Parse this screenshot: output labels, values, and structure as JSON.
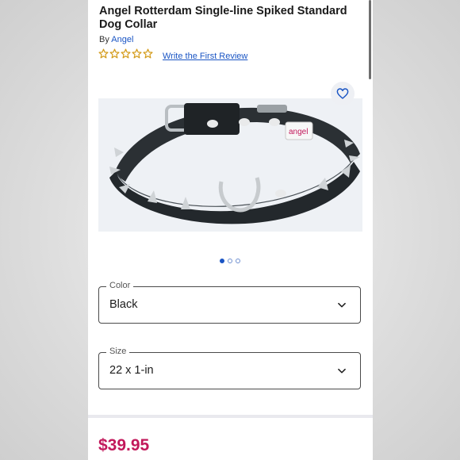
{
  "product": {
    "title": "Angel Rotterdam Single-line Spiked Standard Dog Collar",
    "by_label": "By",
    "brand": "Angel",
    "rating_stars": 0,
    "review_link": "Write the First Review",
    "image_alt": "Black spiked leather dog collar",
    "image_brand_tag": "angel",
    "carousel": {
      "count": 3,
      "active": 0
    }
  },
  "options": {
    "color": {
      "label": "Color",
      "value": "Black"
    },
    "size": {
      "label": "Size",
      "value": "22 x 1-in"
    }
  },
  "price": "$39.95",
  "colors": {
    "accent": "#1a55c4",
    "star": "#d39a17",
    "price": "#c2185b",
    "collar": "#2b3034"
  },
  "icons": {
    "favorite": "heart-outline-icon",
    "dropdown": "chevron-down-icon",
    "rating": "star-outline-icon"
  }
}
